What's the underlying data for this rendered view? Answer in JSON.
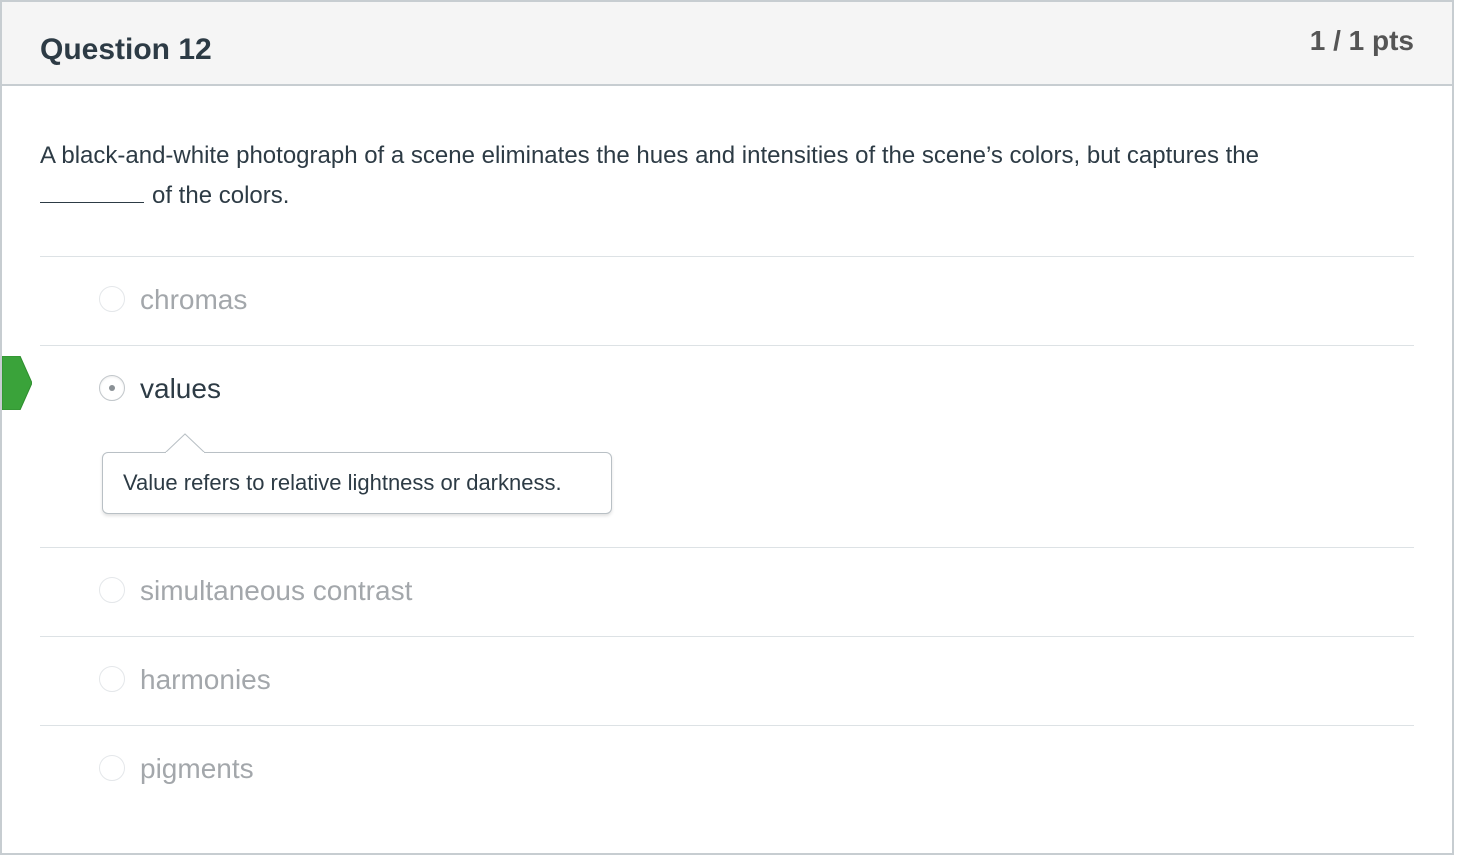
{
  "question": {
    "title": "Question 12",
    "points": "1 / 1 pts",
    "text_before_blank": "A black-and-white photograph of a scene eliminates the hues and intensities of the scene’s colors, but captures the",
    "blank": "________",
    "text_after_blank": "of the colors."
  },
  "answers": [
    {
      "label": "chromas",
      "selected": false
    },
    {
      "label": "values",
      "selected": true,
      "correct": true,
      "comment": "Value refers to relative lightness or darkness."
    },
    {
      "label": "simultaneous contrast",
      "selected": false
    },
    {
      "label": "harmonies",
      "selected": false
    },
    {
      "label": "pigments",
      "selected": false
    }
  ],
  "colors": {
    "correct_marker": "#3aa33a",
    "header_bg": "#f5f5f5",
    "unselected_text": "#a3a7ab",
    "text": "#2d3b45"
  },
  "icons": {
    "correct_marker": "correct-answer-arrow-icon"
  }
}
